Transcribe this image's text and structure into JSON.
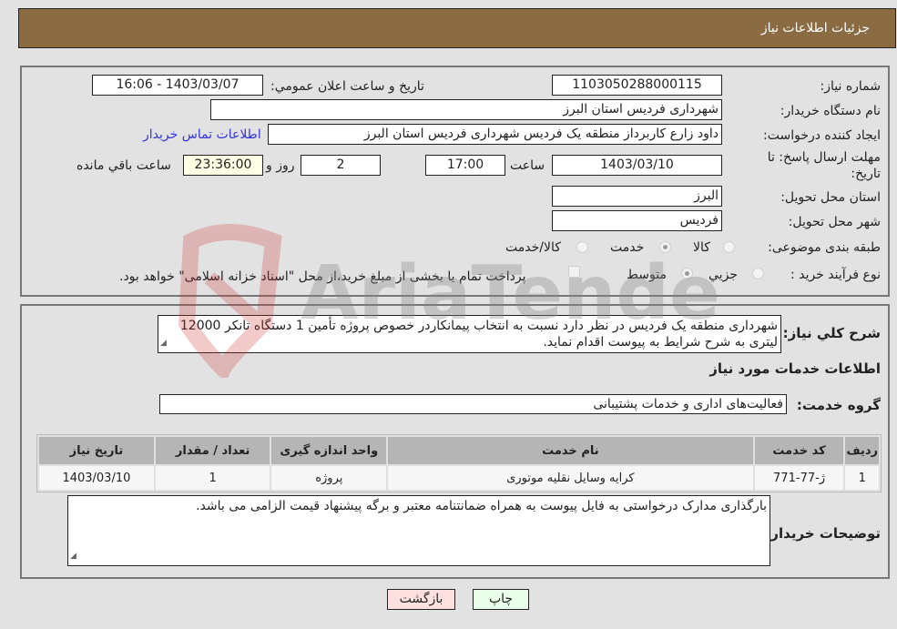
{
  "header": {
    "title": "جزئیات اطلاعات نیاز"
  },
  "fields": {
    "need_number": {
      "label": "شماره نیاز:",
      "value": "1103050288000115"
    },
    "announce_datetime": {
      "label": "تاریخ و ساعت اعلان عمومي:",
      "value": "1403/03/07 - 16:06"
    },
    "buyer_org": {
      "label": "نام دستگاه خریدار:",
      "value": "شهرداری فردیس استان البرز"
    },
    "requester": {
      "label": "ایجاد کننده درخواست:",
      "value": "داود زارع کاربرداز منطقه یک فردیس شهرداری فردیس استان البرز"
    },
    "buyer_contact_link": "اطلاعات تماس خریدار",
    "deadline": {
      "label_line1": "مهلت ارسال پاسخ: تا",
      "label_line2": "تاریخ:",
      "date": "1403/03/10",
      "time_label": "ساعت",
      "time": "17:00",
      "days": "2",
      "days_label": "روز و",
      "remaining": "23:36:00",
      "remaining_label": "ساعت باقي مانده"
    },
    "delivery_province": {
      "label": "استان محل تحویل:",
      "value": "البرز"
    },
    "delivery_city": {
      "label": "شهر محل تحویل:",
      "value": "فردیس"
    },
    "category": {
      "label": "طبقه بندی موضوعی:",
      "options": [
        "کالا",
        "خدمت",
        "کالا/خدمت"
      ],
      "selected": "خدمت"
    },
    "purchase_type": {
      "label": "نوع فرآیند خرید :",
      "options": [
        "جزيي",
        "متوسط"
      ],
      "selected": "متوسط",
      "treasury_checkbox_label": "پرداخت تمام یا بخشی از مبلغ خرید،از محل \"اسناد خزانه اسلامی\" خواهد بود.",
      "treasury_checked": false
    }
  },
  "description": {
    "label": "شرح کلي نیاز:",
    "value": "شهرداری منطقه یک فردیس در نظر دارد نسبت به انتخاب پیمانکاردر خصوص پروژه تأمین 1 دستگاه تانکر 12000 لیتری به شرح شرایط به پیوست اقدام نماید."
  },
  "services_section": {
    "title": "اطلاعات خدمات مورد نیاز",
    "group_label": "گروه خدمت:",
    "group_value": "فعالیت‌های اداری و خدمات پشتیبانی"
  },
  "table": {
    "headers": [
      "ردیف",
      "کد خدمت",
      "نام خدمت",
      "واحد اندازه گیری",
      "تعداد / مقدار",
      "تاریخ نیاز"
    ],
    "rows": [
      [
        "1",
        "ژ-77-771",
        "کرایه وسایل نقلیه موتوری",
        "پروژه",
        "1",
        "1403/03/10"
      ]
    ]
  },
  "buyer_notes": {
    "label": "توضیحات خریدار:",
    "value": "بارگذاری مدارک درخواستی به فایل پیوست به همراه ضمانتنامه معتبر و برگه پیشنهاد قیمت الزامی می باشد."
  },
  "buttons": {
    "print": "چاپ",
    "back": "بازگشت"
  },
  "colors": {
    "header_bg": "#8b6c42",
    "print_bg": "#eaffea",
    "back_bg": "#ffe0e0",
    "link": "#3333dd"
  },
  "watermark": {
    "text": "AriaTender.neT"
  }
}
